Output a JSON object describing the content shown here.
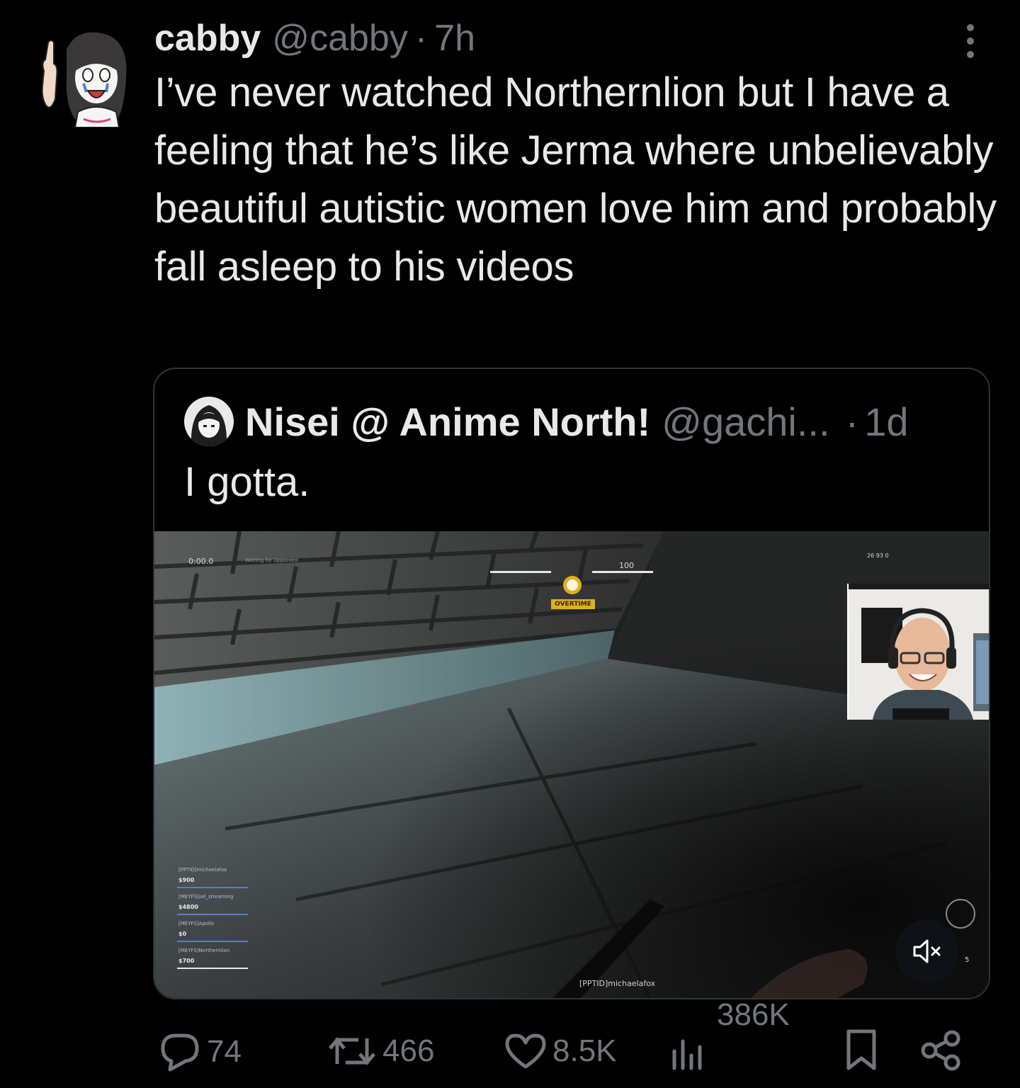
{
  "tweet": {
    "author_name": "cabby",
    "author_handle": "@cabby",
    "separator": "·",
    "time": "7h",
    "text": "I’ve never watched Northernlion but I have a feeling that he’s like Jerma where unbelievably beautiful autistic women love him and probably fall asleep to his videos"
  },
  "quote": {
    "author_name": "Nisei @ Anime North!",
    "author_handle": "@gachi...",
    "separator": "·",
    "time": "1d",
    "text": "I gotta."
  },
  "video": {
    "hud_timer": "0:00.0",
    "hud_status": "Waiting for Opponent",
    "hud_health": "100",
    "overtime_label": "OVERTIME",
    "top_right_stats": "26   93   0",
    "player_tag": "[PPTID]michaelafox",
    "scoreboard": [
      {
        "name": "[PPTID]michaelafox",
        "money": "$900"
      },
      {
        "name": "[MEYFS]sel_streaming",
        "money": "$4800"
      },
      {
        "name": "[MEYFS]Apollo",
        "money": "$0"
      },
      {
        "name": "[MEYFS]Northernlion",
        "money": "$700"
      }
    ],
    "ammo": "5",
    "muted": true
  },
  "actions": {
    "replies": "74",
    "reposts": "466",
    "likes": "8.5K",
    "views": "386K"
  },
  "icons": {
    "more": "more-vertical-icon",
    "reply": "reply-bubble-icon",
    "repost": "repost-arrows-icon",
    "like": "heart-icon",
    "views": "bar-chart-icon",
    "bookmark": "bookmark-icon",
    "share": "share-icon",
    "mute": "speaker-muted-icon"
  },
  "colors": {
    "background": "#000000",
    "text_primary": "#e7e9ea",
    "text_secondary": "#71767b",
    "border": "#2f3336"
  }
}
